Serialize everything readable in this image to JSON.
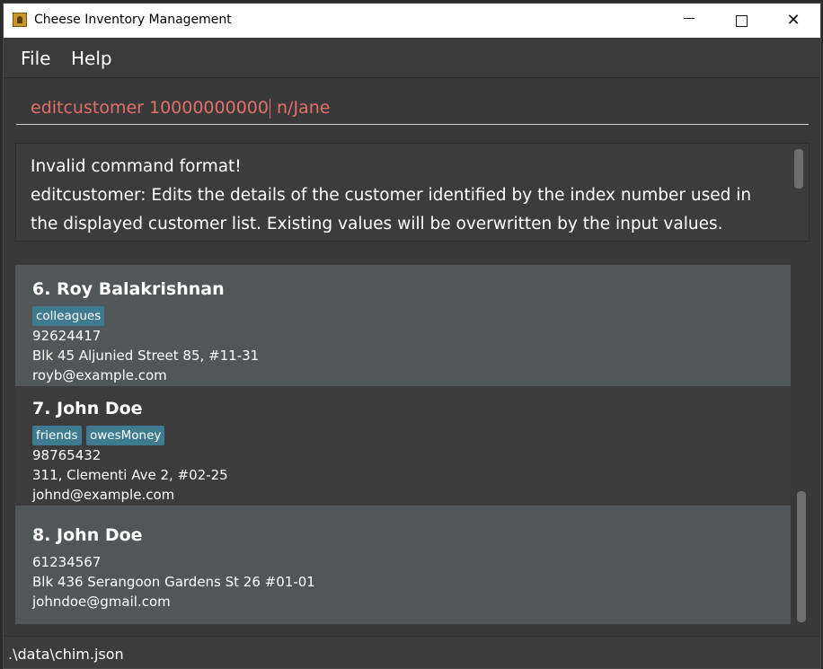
{
  "window": {
    "title": "Cheese Inventory Management",
    "minimize_glyph": "",
    "close_glyph": "✕"
  },
  "menu": {
    "file": "File",
    "help": "Help"
  },
  "command": {
    "before_caret": "editcustomer 10000000000",
    "after_caret": " n/Jane"
  },
  "result": {
    "line1": "Invalid command format!",
    "line2": "editcustomer: Edits the details of the customer identified by the index number used in the displayed customer list. Existing values will be overwritten by the input values."
  },
  "customers": [
    {
      "index_name": "6.  Roy Balakrishnan",
      "tags": [
        "colleagues"
      ],
      "phone": "92624417",
      "address": "Blk 45 Aljunied Street 85, #11-31",
      "email": "royb@example.com"
    },
    {
      "index_name": "7.  John Doe",
      "tags": [
        "friends",
        "owesMoney"
      ],
      "phone": "98765432",
      "address": "311, Clementi Ave 2, #02-25",
      "email": "johnd@example.com"
    },
    {
      "index_name": "8.  John Doe",
      "tags": [],
      "phone": "61234567",
      "address": "Blk 436 Serangoon Gardens St 26 #01-01",
      "email": "johndoe@gmail.com"
    }
  ],
  "status": {
    "file_path": ".\\data\\chim.json"
  },
  "colors": {
    "command_text": "#e2706a",
    "tag_background": "#3e7b91",
    "card_light": "#515658",
    "card_dark": "#3c3c3c"
  }
}
